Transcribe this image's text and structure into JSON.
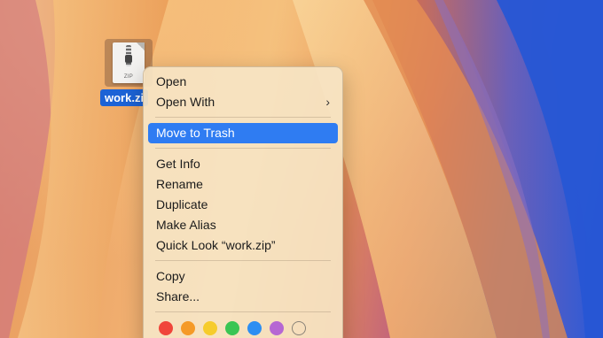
{
  "desktop": {
    "file": {
      "name": "work.zi",
      "icon": "zip-archive-icon",
      "icon_label": "ZIP",
      "selected": true
    }
  },
  "context_menu": {
    "groups": [
      [
        {
          "label": "Open"
        },
        {
          "label": "Open With",
          "submenu": true,
          "chevron": "›"
        }
      ],
      [
        {
          "label": "Move to Trash",
          "highlighted": true
        }
      ],
      [
        {
          "label": "Get Info"
        },
        {
          "label": "Rename"
        },
        {
          "label": "Duplicate"
        },
        {
          "label": "Make Alias"
        },
        {
          "label": "Quick Look “work.zip”"
        }
      ],
      [
        {
          "label": "Copy"
        },
        {
          "label": "Share..."
        }
      ]
    ],
    "tags": [
      {
        "name": "red",
        "color": "#f0453a"
      },
      {
        "name": "orange",
        "color": "#f59a27"
      },
      {
        "name": "yellow",
        "color": "#f6cc2c"
      },
      {
        "name": "green",
        "color": "#3ac553"
      },
      {
        "name": "blue",
        "color": "#2d8ef2"
      },
      {
        "name": "purple",
        "color": "#b667d3"
      },
      {
        "name": "none",
        "color": "transparent"
      }
    ]
  }
}
